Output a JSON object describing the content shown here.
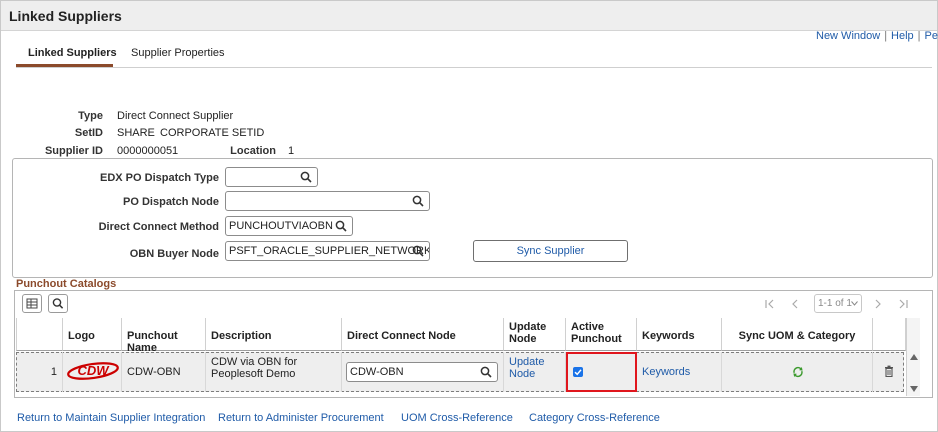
{
  "page": {
    "title": "Linked Suppliers"
  },
  "toplinks": {
    "new_window": "New Window",
    "sep": "|",
    "help": "Help",
    "personalize": "Pe"
  },
  "tabs": [
    {
      "label": "Linked Suppliers",
      "active": true
    },
    {
      "label": "Supplier Properties",
      "active": false
    }
  ],
  "info": {
    "type_label": "Type",
    "type_value": "Direct Connect Supplier",
    "setid_label": "SetID",
    "setid_value": "SHARE",
    "setid_desc": "CORPORATE SETID",
    "supplier_label": "Supplier ID",
    "supplier_value": "0000000051",
    "location_label": "Location",
    "location_value": "1"
  },
  "form": {
    "edx_label": "EDX PO Dispatch Type",
    "edx_value": "",
    "po_node_label": "PO Dispatch Node",
    "po_node_value": "",
    "method_label": "Direct Connect Method",
    "method_value": "PUNCHOUTVIAOBN",
    "obn_label": "OBN Buyer Node",
    "obn_value": "PSFT_ORACLE_SUPPLIER_NETWORK",
    "sync_button": "Sync Supplier"
  },
  "grid": {
    "title": "Punchout Catalogs",
    "pager_text": "1-1 of 1",
    "columns": {
      "logo": "Logo",
      "name": "Punchout Name",
      "desc": "Description",
      "node": "Direct Connect Node",
      "update1": "Update",
      "update2": "Node",
      "active1": "Active",
      "active2": "Punchout",
      "keywords": "Keywords",
      "sync": "Sync UOM & Category"
    },
    "row": {
      "num": "1",
      "logo_text": "CDW",
      "name": "CDW-OBN",
      "desc": "CDW via OBN for Peoplesoft Demo",
      "node": "CDW-OBN",
      "update_link": "Update Node",
      "active_punchout": true,
      "keywords_link": "Keywords"
    }
  },
  "bottom_links": {
    "maintain": "Return to Maintain Supplier Integration",
    "administer": "Return to Administer Procurement",
    "uom": "UOM Cross-Reference",
    "category": "Category Cross-Reference"
  },
  "colors": {
    "accent": "#8b4a2b",
    "link": "#1f5ba8",
    "highlight": "#e0161d",
    "logo_red": "#cc0000"
  }
}
